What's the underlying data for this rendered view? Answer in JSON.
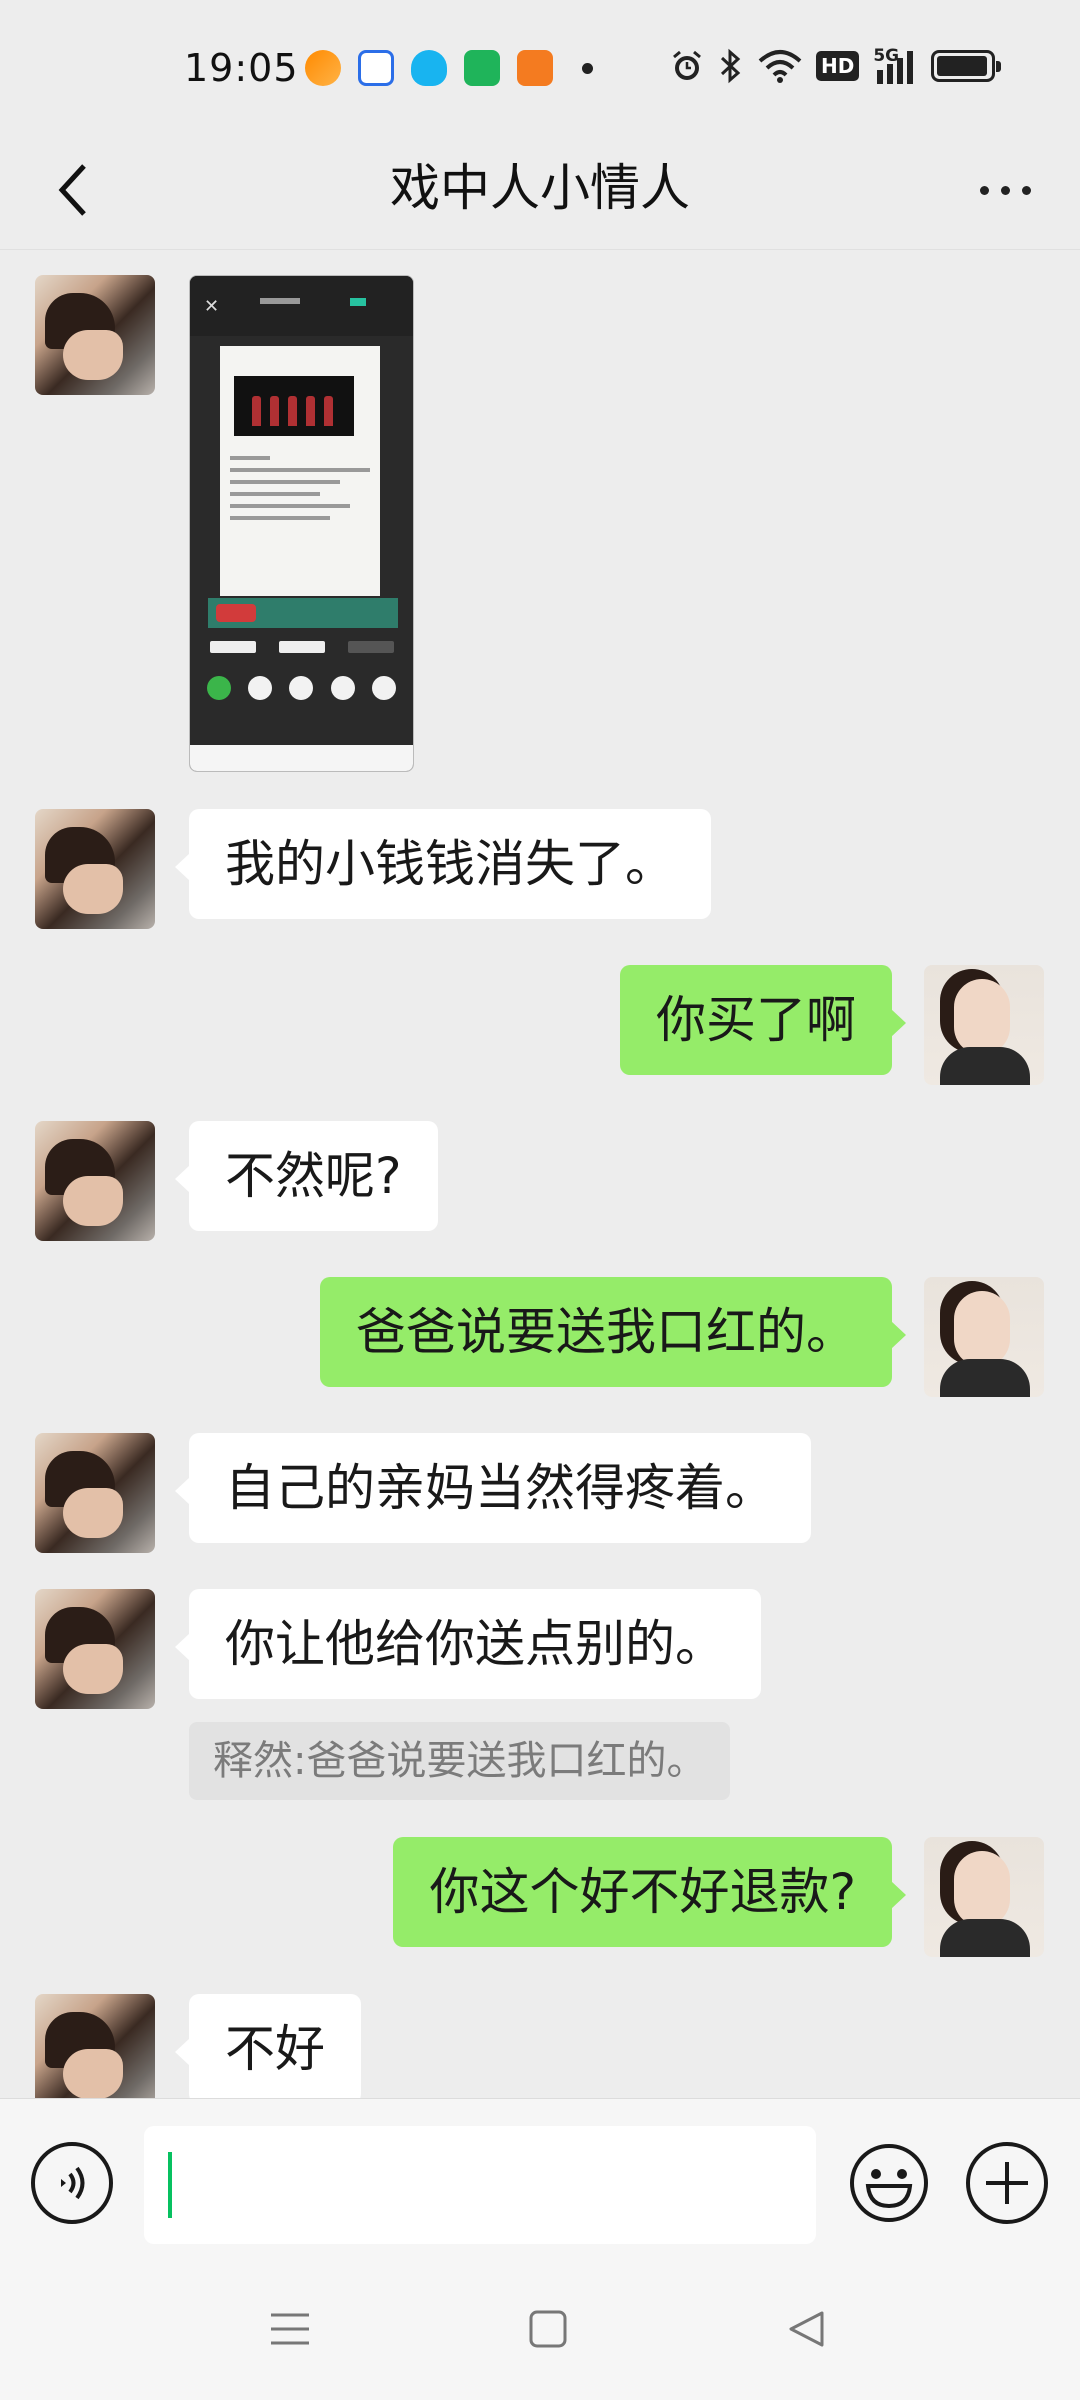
{
  "status_bar": {
    "time": "19:05",
    "hd_label": "HD",
    "network_label": "5G",
    "battery_level": 0.95,
    "app_icons": [
      "orange-app-icon",
      "baidu-icon",
      "qq-icon",
      "shopping-icon",
      "reader-icon"
    ],
    "system_icons": [
      "alarm-icon",
      "bluetooth-icon",
      "wifi-icon",
      "signal-icon",
      "battery-icon"
    ]
  },
  "nav": {
    "title": "戏中人小情人",
    "back_icon": "chevron-left-icon",
    "more_icon": "more-dots-icon"
  },
  "messages": [
    {
      "side": "left",
      "type": "image",
      "content": "screenshot-thumbnail"
    },
    {
      "side": "left",
      "type": "text",
      "text": "我的小钱钱消失了。"
    },
    {
      "side": "right",
      "type": "text",
      "text": "你买了啊"
    },
    {
      "side": "left",
      "type": "text",
      "text": "不然呢?"
    },
    {
      "side": "right",
      "type": "text",
      "text": "爸爸说要送我口红的。"
    },
    {
      "side": "left",
      "type": "text",
      "text": "自己的亲妈当然得疼着。"
    },
    {
      "side": "left",
      "type": "text",
      "text": "你让他给你送点别的。",
      "quote": "释然:爸爸说要送我口红的。"
    },
    {
      "side": "right",
      "type": "text",
      "text": "你这个好不好退款?"
    },
    {
      "side": "left",
      "type": "text",
      "text": "不好"
    }
  ],
  "input_bar": {
    "voice_icon": "voice-icon",
    "emoji_icon": "emoji-icon",
    "plus_icon": "plus-icon",
    "value": ""
  },
  "system_nav": [
    "menu-icon",
    "home-icon",
    "back-triangle-icon"
  ],
  "colors": {
    "background": "#ededed",
    "self_bubble": "#95ec69",
    "other_bubble": "#ffffff",
    "caret": "#07c160"
  }
}
